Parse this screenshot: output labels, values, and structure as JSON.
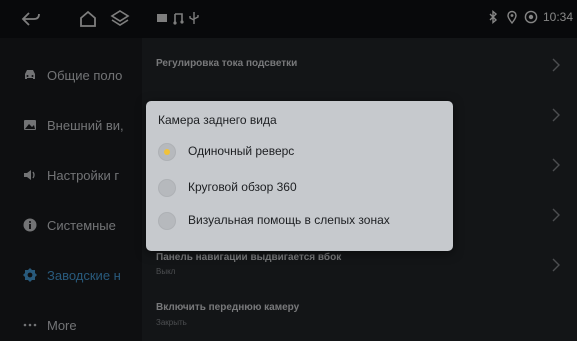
{
  "status_bar": {
    "time": "10:34",
    "nav_icons": [
      "back-icon",
      "home-icon",
      "layers-icon"
    ],
    "media_icons": [
      "screen-icon",
      "music-icon",
      "usb-icon"
    ],
    "status_icons": [
      "bluetooth-icon",
      "location-icon",
      "wifi-icon"
    ]
  },
  "sidebar": {
    "items": [
      {
        "label": "Общие поло",
        "icon": "car-icon"
      },
      {
        "label": "Внешний ви,",
        "icon": "image-icon"
      },
      {
        "label": "Настройки г",
        "icon": "speaker-icon"
      },
      {
        "label": "Системные",
        "icon": "info-icon"
      },
      {
        "label": "Заводские н",
        "icon": "gear-icon"
      },
      {
        "label": "More",
        "icon": "more-icon"
      }
    ],
    "active_index": 4,
    "active_color": "#4aa3e0"
  },
  "content": {
    "rows": [
      {
        "title": "Регулировка тока подсветки",
        "sub": ""
      },
      {
        "title": "",
        "sub": ""
      },
      {
        "title": "",
        "sub": ""
      },
      {
        "title": "",
        "sub": ""
      },
      {
        "title": "Панель навигации выдвигается вбок",
        "sub": "Выкл"
      },
      {
        "title": "Включить переднюю камеру",
        "sub": "Закрыть"
      }
    ]
  },
  "dialog": {
    "title": "Камера заднего вида",
    "options": [
      {
        "label": "Одиночный реверс",
        "checked": true
      },
      {
        "label": "Круговой обзор 360",
        "checked": false
      },
      {
        "label": "Визуальная помощь в слепых зонах",
        "checked": false
      }
    ],
    "check_color": "#f0c23a"
  }
}
